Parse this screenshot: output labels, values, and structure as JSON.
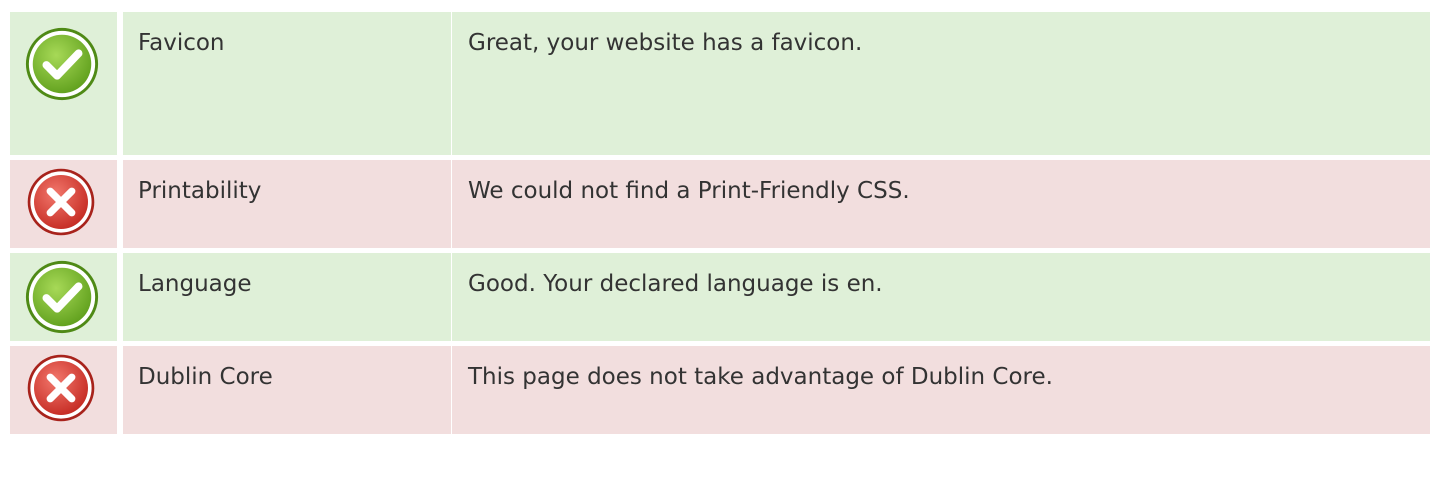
{
  "checks": [
    {
      "status": "pass",
      "icon": "check-icon",
      "label": "Favicon",
      "message": "Great, your website has a favicon."
    },
    {
      "status": "fail",
      "icon": "cross-icon",
      "label": "Printability",
      "message": "We could not find a Print-Friendly CSS."
    },
    {
      "status": "pass",
      "icon": "check-icon",
      "label": "Language",
      "message": "Good. Your declared language is en."
    },
    {
      "status": "fail",
      "icon": "cross-icon",
      "label": "Dublin Core",
      "message": "This page does not take advantage of Dublin Core."
    }
  ],
  "colors": {
    "pass_background": "#dff0d8",
    "fail_background": "#f2dede",
    "pass_icon": "#7cbd2a",
    "fail_icon": "#d93a32",
    "text": "#333333"
  }
}
